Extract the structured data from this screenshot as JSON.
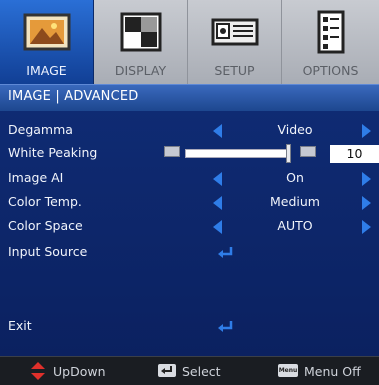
{
  "tabs": [
    {
      "label": "IMAGE",
      "icon": "image-icon",
      "active": true
    },
    {
      "label": "DISPLAY",
      "icon": "display-icon",
      "active": false
    },
    {
      "label": "SETUP",
      "icon": "setup-icon",
      "active": false
    },
    {
      "label": "OPTIONS",
      "icon": "options-icon",
      "active": false
    }
  ],
  "title": "IMAGE | ADVANCED",
  "rows": [
    {
      "label": "Degamma",
      "value": "Video"
    },
    {
      "label": "White Peaking",
      "value": "10",
      "slider_fraction": 1.0
    },
    {
      "label": "Image AI",
      "value": "On"
    },
    {
      "label": "Color Temp.",
      "value": "Medium"
    },
    {
      "label": "Color Space",
      "value": "AUTO"
    },
    {
      "label": "Input Source"
    },
    {
      "label": "Exit"
    }
  ],
  "footer": {
    "updown": "UpDown",
    "select": "Select",
    "menu_off": "Menu Off",
    "menu_key": "Menu"
  },
  "colors": {
    "accent": "#2f7de8",
    "tab_active": "#1f5cc0",
    "background": "#0e2a6e"
  }
}
